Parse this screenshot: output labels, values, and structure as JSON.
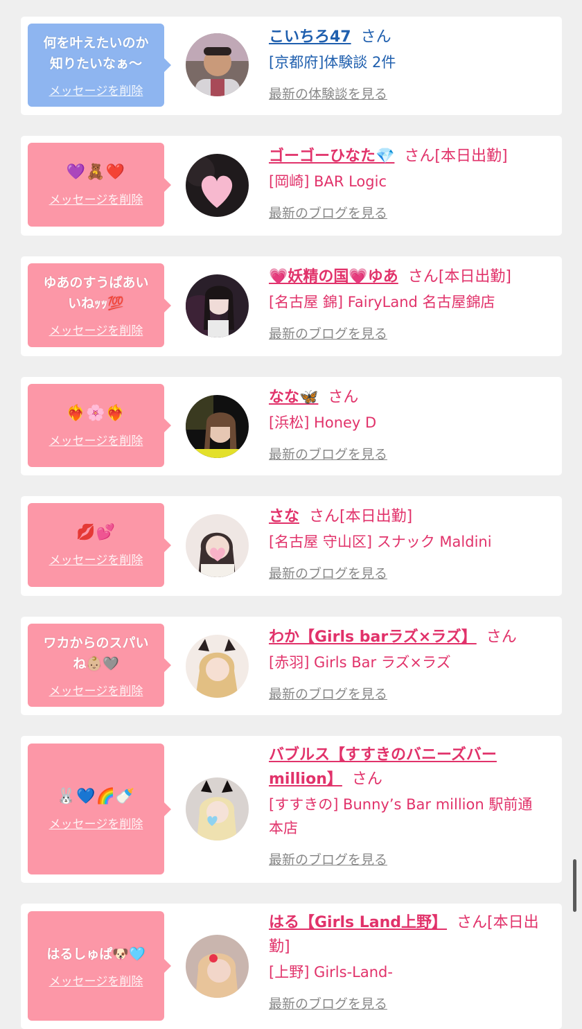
{
  "delete_label": "メッセージを削除",
  "entries": [
    {
      "message": "何を叶えたいのか知りたいなぁ〜",
      "message_lines": [
        "何を叶えたいのか",
        "知りたいなぁ〜"
      ],
      "bubble_color": "blue",
      "name": "こいちろ47",
      "suffix": "さん",
      "status": "",
      "shop": "[京都府]体験談 2件",
      "link": "最新の体験談を見る",
      "avatar": "man-avatar"
    },
    {
      "message": "💜🧸❤️",
      "bubble_color": "pink",
      "name": "ゴーゴーひなた💎",
      "suffix": "さん",
      "status": "[本日出勤]",
      "shop": "[岡崎] BAR Logic",
      "link": "最新のブログを見る",
      "avatar": "heart-avatar"
    },
    {
      "message": "ゆあのすうぱあいいねｯｯ💯",
      "message_lines": [
        "ゆあのすうぱあい",
        "いねｯｯ💯"
      ],
      "bubble_color": "pink",
      "name": "💗妖精の国💗ゆあ",
      "suffix": "さん",
      "status": "[本日出勤]",
      "shop": "[名古屋 錦] FairyLand 名古屋錦店",
      "link": "最新のブログを見る",
      "avatar": "girl-avatar-dark"
    },
    {
      "message": "❤️‍🔥🌸❤️‍🔥",
      "bubble_color": "pink",
      "name": "なな🦋",
      "suffix": "さん",
      "status": "",
      "shop": "[浜松] Honey D",
      "link": "最新のブログを見る",
      "avatar": "girl-avatar-nana"
    },
    {
      "message": "💋💕",
      "bubble_color": "pink",
      "name": "さな",
      "suffix": "さん",
      "status": "[本日出勤]",
      "shop": "[名古屋 守山区] スナック Maldini",
      "link": "最新のブログを見る",
      "avatar": "girl-avatar-light"
    },
    {
      "message": "ワカからのスパいね👶🏼🩶",
      "message_lines": [
        "ワカからのスパい",
        "ね👶🏼🩶"
      ],
      "bubble_color": "pink",
      "name": "わか【Girls barラズ×ラズ】",
      "suffix": "さん",
      "status": "",
      "shop": "[赤羽] Girls Bar ラズ×ラズ",
      "link": "最新のブログを見る",
      "avatar": "girl-avatar-blonde"
    },
    {
      "message": "🐰💙🌈🍼",
      "bubble_color": "pink",
      "name_lines": [
        "バブルス【すすきのバニーズバー",
        "million】"
      ],
      "name": "バブルス【すすきのバニーズバーmillion】",
      "suffix": "さん",
      "status": "",
      "shop_lines": [
        "[すすきの] Bunny’s Bar million 駅前通",
        "本店"
      ],
      "shop": "[すすきの] Bunny’s Bar million 駅前通本店",
      "link": "最新のブログを見る",
      "avatar": "girl-avatar-bunny"
    },
    {
      "message": "はるしゅぱ🐶🩵",
      "bubble_color": "pink",
      "name": "はる【Girls Land上野】",
      "suffix": "さん",
      "status_lines": [
        "[本日出",
        "勤]"
      ],
      "status": "[本日出勤]",
      "shop": "[上野] Girls-Land-",
      "link": "最新のブログを見る",
      "avatar": "girl-avatar-haru"
    }
  ]
}
